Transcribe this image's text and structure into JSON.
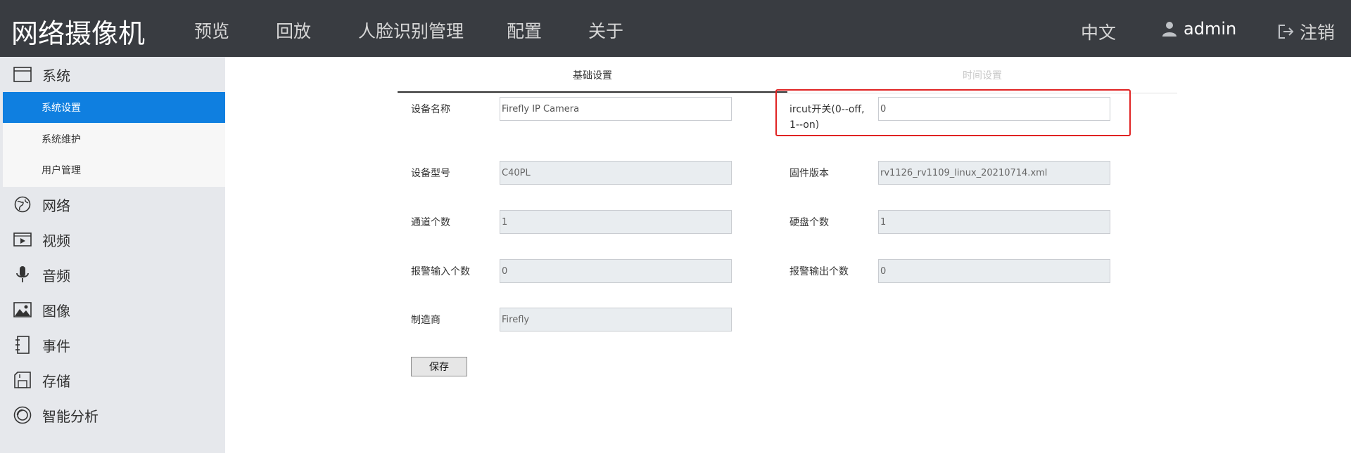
{
  "header": {
    "brand": "网络摄像机",
    "nav": [
      "预览",
      "回放",
      "人脸识别管理",
      "配置",
      "关于"
    ],
    "language": "中文",
    "user": "admin",
    "logout": "注销"
  },
  "sidebar": {
    "system_label": "系统",
    "submenu": [
      "系统设置",
      "系统维护",
      "用户管理"
    ],
    "active_submenu": "系统设置",
    "items": [
      {
        "label": "网络",
        "icon": "globe-icon"
      },
      {
        "label": "视频",
        "icon": "video-icon"
      },
      {
        "label": "音频",
        "icon": "microphone-icon"
      },
      {
        "label": "图像",
        "icon": "image-icon"
      },
      {
        "label": "事件",
        "icon": "event-icon"
      },
      {
        "label": "存储",
        "icon": "storage-icon"
      },
      {
        "label": "智能分析",
        "icon": "analysis-icon"
      }
    ]
  },
  "tabs": {
    "basic": "基础设置",
    "time": "时间设置"
  },
  "form": {
    "device_name_label": "设备名称",
    "device_name": "Firefly IP Camera",
    "ircut_label": "ircut开关(0--off, 1--on)",
    "ircut": "0",
    "model_label": "设备型号",
    "model": "C40PL",
    "firmware_label": "固件版本",
    "firmware": "rv1126_rv1109_linux_20210714.xml",
    "channels_label": "通道个数",
    "channels": "1",
    "disks_label": "硬盘个数",
    "disks": "1",
    "alarm_in_label": "报警输入个数",
    "alarm_in": "0",
    "alarm_out_label": "报警输出个数",
    "alarm_out": "0",
    "manufacturer_label": "制造商",
    "manufacturer": "Firefly",
    "save_label": "保存"
  },
  "colors": {
    "header_bg": "#393c41",
    "sidebar_bg": "#e6e8ec",
    "active_item": "#0f7fe0",
    "highlight_border": "#e02323"
  }
}
